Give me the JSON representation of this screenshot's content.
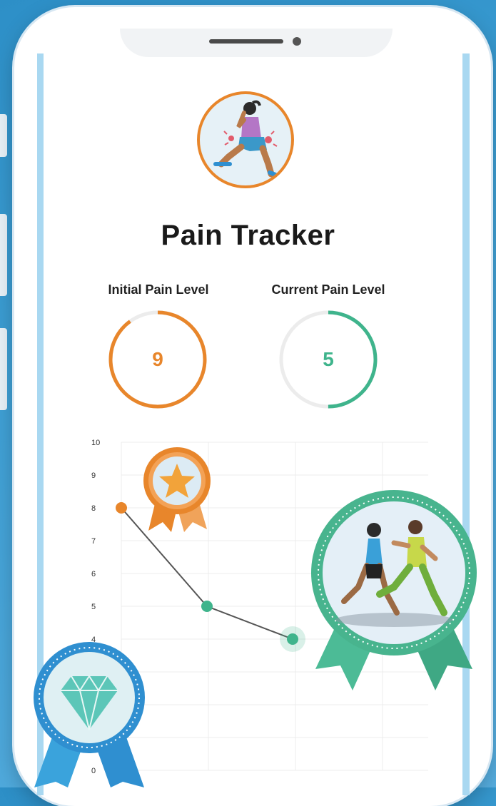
{
  "app": {
    "title": "Pain Tracker"
  },
  "gauges": [
    {
      "label": "Initial Pain Level",
      "value": "9",
      "fraction": 0.9,
      "color": "#e8862b"
    },
    {
      "label": "Current Pain Level",
      "value": "5",
      "fraction": 0.5,
      "color": "#3fb48c"
    }
  ],
  "chart_data": {
    "type": "line",
    "y_ticks": [
      "10",
      "9",
      "8",
      "7",
      "6",
      "5",
      "4",
      "0"
    ],
    "ylim": [
      0,
      10
    ],
    "grid": true,
    "points": [
      {
        "x": 1,
        "y": 8,
        "color": "#e8862b"
      },
      {
        "x": 2,
        "y": 5,
        "color": "#3fb48c"
      },
      {
        "x": 3,
        "y": 4,
        "color": "#3fb48c"
      }
    ]
  },
  "icons": {
    "avatar": "lunging-woman-knee-pain-icon",
    "star_badge": "star-medal-icon",
    "runners_badge": "runners-medal-icon",
    "diamond_badge": "diamond-medal-icon"
  },
  "colors": {
    "orange": "#e8862b",
    "green": "#3fb48c",
    "blue": "#2f8fd0"
  }
}
